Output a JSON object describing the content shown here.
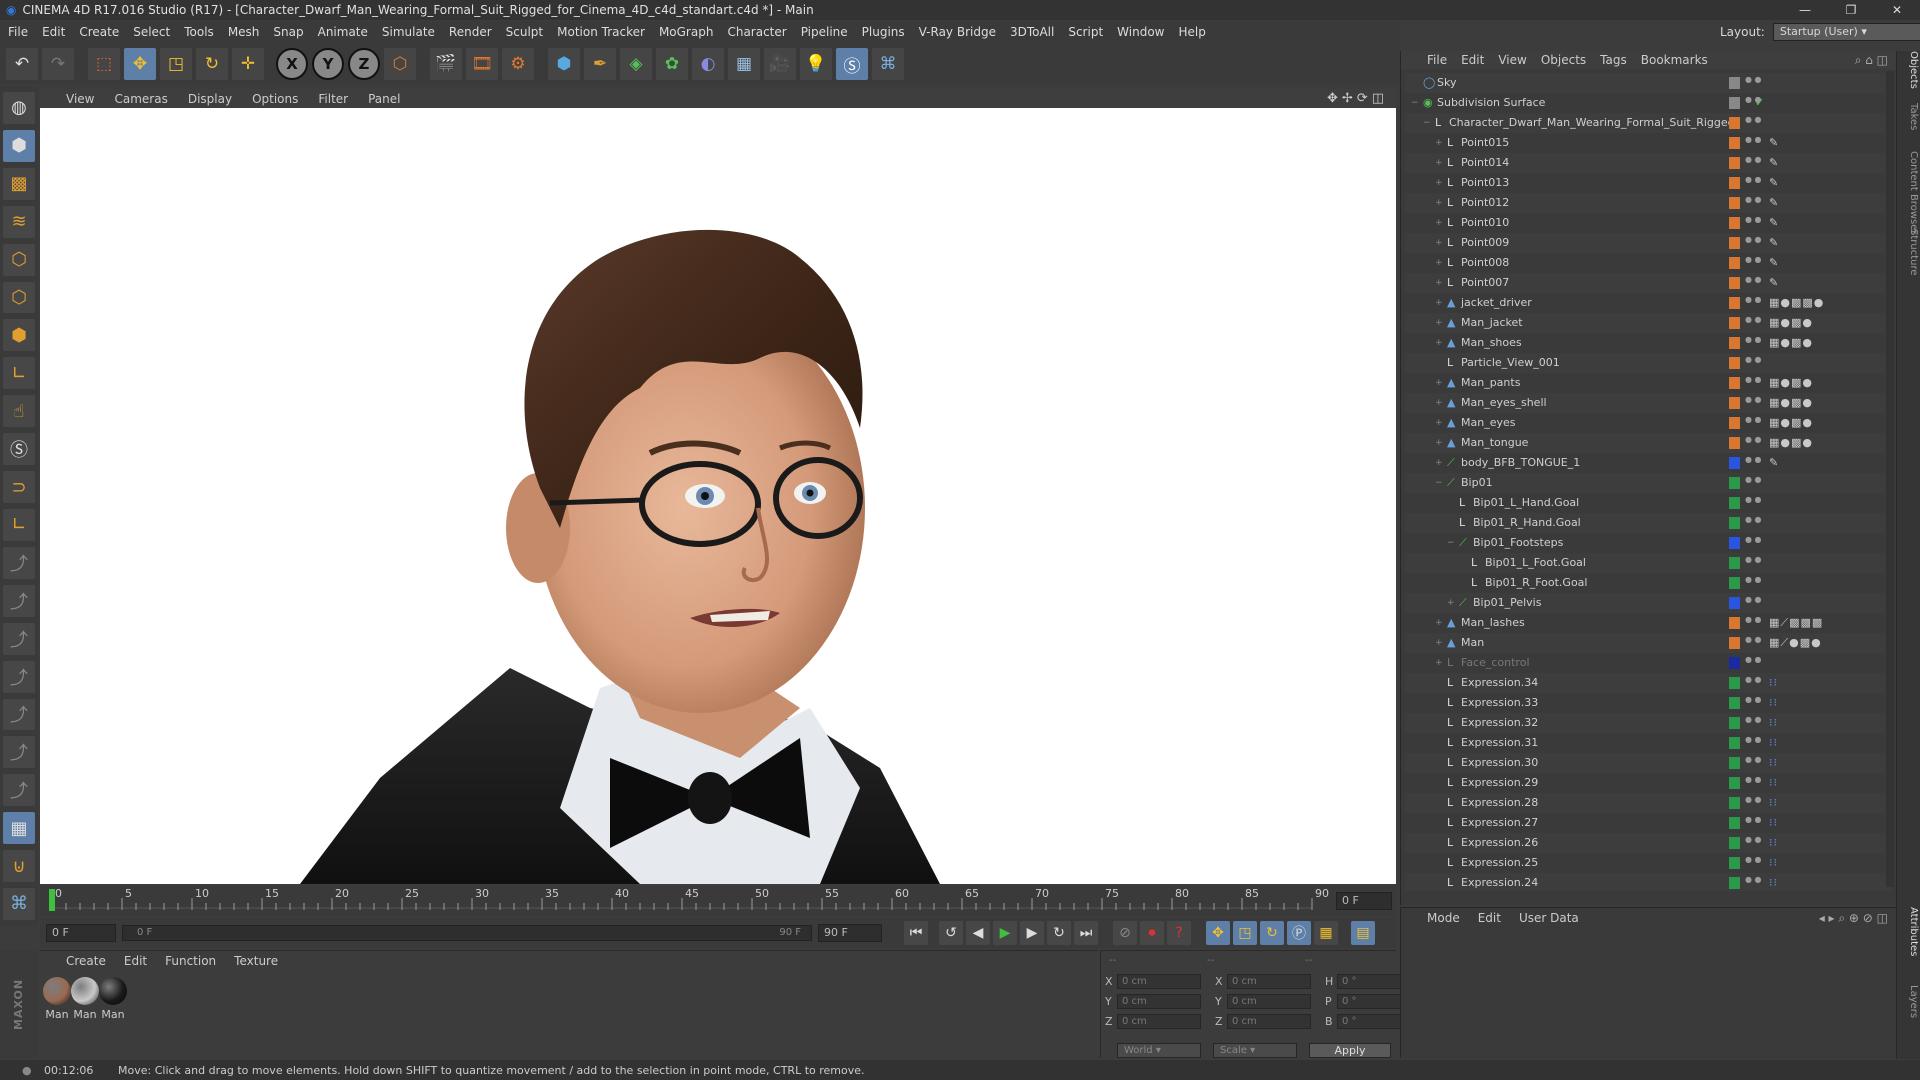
{
  "window": {
    "title": "CINEMA 4D R17.016 Studio (R17) - [Character_Dwarf_Man_Wearing_Formal_Suit_Rigged_for_Cinema_4D_c4d_standart.c4d *] - Main",
    "controls": [
      "—",
      "❐",
      "✕"
    ]
  },
  "menubar": [
    "File",
    "Edit",
    "Create",
    "Select",
    "Tools",
    "Mesh",
    "Snap",
    "Animate",
    "Simulate",
    "Render",
    "Sculpt",
    "Motion Tracker",
    "MoGraph",
    "Character",
    "Pipeline",
    "Plugins",
    "V-Ray Bridge",
    "3DToAll",
    "Script",
    "Window",
    "Help"
  ],
  "layout": {
    "label": "Layout:",
    "value": "Startup (User)"
  },
  "toolbar": {
    "axes": [
      "X",
      "Y",
      "Z"
    ],
    "icons": [
      "undo-icon",
      "redo-icon",
      "live-select-icon",
      "move-icon",
      "scale-icon",
      "rotate-icon",
      "last-tool-icon",
      "coordinate-system-icon",
      "render-view-icon",
      "render-picture-viewer-icon",
      "render-settings-icon",
      "cube-icon",
      "pen-icon",
      "subdivision-icon",
      "cloner-icon",
      "deformer-icon",
      "floor-icon",
      "camera-icon",
      "light-icon",
      "spline-tool-icon",
      "python-icon"
    ]
  },
  "viewport": {
    "menu": [
      "View",
      "Cameras",
      "Display",
      "Options",
      "Filter",
      "Panel"
    ]
  },
  "timeline": {
    "ticks": [
      "0",
      "5",
      "10",
      "15",
      "20",
      "25",
      "30",
      "35",
      "40",
      "45",
      "50",
      "55",
      "60",
      "65",
      "70",
      "75",
      "80",
      "85",
      "90"
    ],
    "current_frame": "0 F",
    "start_field": "0 F",
    "range_start": "0 F",
    "range_end": "90 F",
    "end_field": "90 F"
  },
  "materials": {
    "menu": [
      "Create",
      "Edit",
      "Function",
      "Texture"
    ],
    "items": [
      {
        "label": "Man",
        "color": "#9a6a52"
      },
      {
        "label": "Man",
        "color": "#c9c9c9"
      },
      {
        "label": "Man",
        "color": "#1a1a1a"
      }
    ]
  },
  "coords": {
    "header": [
      "--",
      "--",
      "--"
    ],
    "rows": [
      {
        "a": "X",
        "av": "0 cm",
        "b": "X",
        "bv": "0 cm",
        "c": "H",
        "cv": "0 °"
      },
      {
        "a": "Y",
        "av": "0 cm",
        "b": "Y",
        "bv": "0 cm",
        "c": "P",
        "cv": "0 °"
      },
      {
        "a": "Z",
        "av": "0 cm",
        "b": "Z",
        "bv": "0 cm",
        "c": "B",
        "cv": "0 °"
      }
    ],
    "world": "World",
    "scale": "Scale",
    "apply": "Apply"
  },
  "status": {
    "time": "00:12:06",
    "message": "Move: Click and drag to move elements. Hold down SHIFT to quantize movement / add to the selection in point mode, CTRL to remove."
  },
  "objects_menu": [
    "File",
    "Edit",
    "View",
    "Objects",
    "Tags",
    "Bookmarks"
  ],
  "objects": [
    {
      "name": "Sky",
      "depth": 0,
      "ex": "",
      "icon": "◯",
      "iconColor": "#6aa0d8",
      "sq": "#888888",
      "check": "",
      "tags": ""
    },
    {
      "name": "Subdivision Surface",
      "depth": 0,
      "ex": "−",
      "icon": "◉",
      "iconColor": "#55c055",
      "sq": "#888888",
      "check": "✓",
      "tags": ""
    },
    {
      "name": "Character_Dwarf_Man_Wearing_Formal_Suit_Rigged",
      "depth": 1,
      "ex": "−",
      "icon": "L",
      "iconColor": "#dddddd",
      "sq": "#d9762f",
      "check": "",
      "tags": ""
    },
    {
      "name": "Point015",
      "depth": 2,
      "ex": "+",
      "icon": "L",
      "iconColor": "#dddddd",
      "sq": "#d9762f",
      "check": "",
      "tags": "✎"
    },
    {
      "name": "Point014",
      "depth": 2,
      "ex": "+",
      "icon": "L",
      "iconColor": "#dddddd",
      "sq": "#d9762f",
      "check": "",
      "tags": "✎"
    },
    {
      "name": "Point013",
      "depth": 2,
      "ex": "+",
      "icon": "L",
      "iconColor": "#dddddd",
      "sq": "#d9762f",
      "check": "",
      "tags": "✎"
    },
    {
      "name": "Point012",
      "depth": 2,
      "ex": "+",
      "icon": "L",
      "iconColor": "#dddddd",
      "sq": "#d9762f",
      "check": "",
      "tags": "✎"
    },
    {
      "name": "Point010",
      "depth": 2,
      "ex": "+",
      "icon": "L",
      "iconColor": "#dddddd",
      "sq": "#d9762f",
      "check": "",
      "tags": "✎"
    },
    {
      "name": "Point009",
      "depth": 2,
      "ex": "+",
      "icon": "L",
      "iconColor": "#dddddd",
      "sq": "#d9762f",
      "check": "",
      "tags": "✎"
    },
    {
      "name": "Point008",
      "depth": 2,
      "ex": "+",
      "icon": "L",
      "iconColor": "#dddddd",
      "sq": "#d9762f",
      "check": "",
      "tags": "✎"
    },
    {
      "name": "Point007",
      "depth": 2,
      "ex": "+",
      "icon": "L",
      "iconColor": "#dddddd",
      "sq": "#d9762f",
      "check": "",
      "tags": "✎"
    },
    {
      "name": "jacket_driver",
      "depth": 2,
      "ex": "+",
      "icon": "▲",
      "iconColor": "#6aa0d8",
      "sq": "#d9762f",
      "check": "",
      "tags": "▦●▩▩●"
    },
    {
      "name": "Man_jacket",
      "depth": 2,
      "ex": "+",
      "icon": "▲",
      "iconColor": "#6aa0d8",
      "sq": "#d9762f",
      "check": "",
      "tags": "▦●▩●"
    },
    {
      "name": "Man_shoes",
      "depth": 2,
      "ex": "+",
      "icon": "▲",
      "iconColor": "#6aa0d8",
      "sq": "#d9762f",
      "check": "",
      "tags": "▦●▩●"
    },
    {
      "name": "Particle_View_001",
      "depth": 2,
      "ex": "",
      "icon": "L",
      "iconColor": "#dddddd",
      "sq": "#d9762f",
      "check": "",
      "tags": ""
    },
    {
      "name": "Man_pants",
      "depth": 2,
      "ex": "+",
      "icon": "▲",
      "iconColor": "#6aa0d8",
      "sq": "#d9762f",
      "check": "",
      "tags": "▦●▩●"
    },
    {
      "name": "Man_eyes_shell",
      "depth": 2,
      "ex": "+",
      "icon": "▲",
      "iconColor": "#6aa0d8",
      "sq": "#d9762f",
      "check": "",
      "tags": "▦●▩●"
    },
    {
      "name": "Man_eyes",
      "depth": 2,
      "ex": "+",
      "icon": "▲",
      "iconColor": "#6aa0d8",
      "sq": "#d9762f",
      "check": "",
      "tags": "▦●▩●"
    },
    {
      "name": "Man_tongue",
      "depth": 2,
      "ex": "+",
      "icon": "▲",
      "iconColor": "#6aa0d8",
      "sq": "#d9762f",
      "check": "",
      "tags": "▦●▩●"
    },
    {
      "name": "body_BFB_TONGUE_1",
      "depth": 2,
      "ex": "+",
      "icon": "⟋",
      "iconColor": "#55c055",
      "sq": "#2a55e0",
      "check": "",
      "tags": "✎"
    },
    {
      "name": "Bip01",
      "depth": 2,
      "ex": "−",
      "icon": "⟋",
      "iconColor": "#55c055",
      "sq": "#2a9a4a",
      "check": "",
      "tags": ""
    },
    {
      "name": "Bip01_L_Hand.Goal",
      "depth": 3,
      "ex": "",
      "icon": "L",
      "iconColor": "#dddddd",
      "sq": "#2a9a4a",
      "check": "",
      "tags": ""
    },
    {
      "name": "Bip01_R_Hand.Goal",
      "depth": 3,
      "ex": "",
      "icon": "L",
      "iconColor": "#dddddd",
      "sq": "#2a9a4a",
      "check": "",
      "tags": ""
    },
    {
      "name": "Bip01_Footsteps",
      "depth": 3,
      "ex": "−",
      "icon": "⟋",
      "iconColor": "#55c055",
      "sq": "#2a55e0",
      "check": "",
      "tags": ""
    },
    {
      "name": "Bip01_L_Foot.Goal",
      "depth": 4,
      "ex": "",
      "icon": "L",
      "iconColor": "#dddddd",
      "sq": "#2a9a4a",
      "check": "",
      "tags": ""
    },
    {
      "name": "Bip01_R_Foot.Goal",
      "depth": 4,
      "ex": "",
      "icon": "L",
      "iconColor": "#dddddd",
      "sq": "#2a9a4a",
      "check": "",
      "tags": ""
    },
    {
      "name": "Bip01_Pelvis",
      "depth": 3,
      "ex": "+",
      "icon": "⟋",
      "iconColor": "#55c055",
      "sq": "#2a55e0",
      "check": "",
      "tags": ""
    },
    {
      "name": "Man_lashes",
      "depth": 2,
      "ex": "+",
      "icon": "▲",
      "iconColor": "#6aa0d8",
      "sq": "#d9762f",
      "check": "",
      "tags": "▦⟋▩▩▩"
    },
    {
      "name": "Man",
      "depth": 2,
      "ex": "+",
      "icon": "▲",
      "iconColor": "#6aa0d8",
      "sq": "#d9762f",
      "check": "",
      "tags": "▦⟋●▩●"
    },
    {
      "name": "Face_control",
      "depth": 2,
      "ex": "+",
      "icon": "L",
      "iconColor": "#777777",
      "sq": "#1a2aa0",
      "check": "",
      "tags": "",
      "dim": true
    },
    {
      "name": "Expression.34",
      "depth": 2,
      "ex": "",
      "icon": "L",
      "iconColor": "#dddddd",
      "sq": "#2a9a4a",
      "check": "",
      "tags": "⁝⁝"
    },
    {
      "name": "Expression.33",
      "depth": 2,
      "ex": "",
      "icon": "L",
      "iconColor": "#dddddd",
      "sq": "#2a9a4a",
      "check": "",
      "tags": "⁝⁝"
    },
    {
      "name": "Expression.32",
      "depth": 2,
      "ex": "",
      "icon": "L",
      "iconColor": "#dddddd",
      "sq": "#2a9a4a",
      "check": "",
      "tags": "⁝⁝"
    },
    {
      "name": "Expression.31",
      "depth": 2,
      "ex": "",
      "icon": "L",
      "iconColor": "#dddddd",
      "sq": "#2a9a4a",
      "check": "",
      "tags": "⁝⁝"
    },
    {
      "name": "Expression.30",
      "depth": 2,
      "ex": "",
      "icon": "L",
      "iconColor": "#dddddd",
      "sq": "#2a9a4a",
      "check": "",
      "tags": "⁝⁝"
    },
    {
      "name": "Expression.29",
      "depth": 2,
      "ex": "",
      "icon": "L",
      "iconColor": "#dddddd",
      "sq": "#2a9a4a",
      "check": "",
      "tags": "⁝⁝"
    },
    {
      "name": "Expression.28",
      "depth": 2,
      "ex": "",
      "icon": "L",
      "iconColor": "#dddddd",
      "sq": "#2a9a4a",
      "check": "",
      "tags": "⁝⁝"
    },
    {
      "name": "Expression.27",
      "depth": 2,
      "ex": "",
      "icon": "L",
      "iconColor": "#dddddd",
      "sq": "#2a9a4a",
      "check": "",
      "tags": "⁝⁝"
    },
    {
      "name": "Expression.26",
      "depth": 2,
      "ex": "",
      "icon": "L",
      "iconColor": "#dddddd",
      "sq": "#2a9a4a",
      "check": "",
      "tags": "⁝⁝"
    },
    {
      "name": "Expression.25",
      "depth": 2,
      "ex": "",
      "icon": "L",
      "iconColor": "#dddddd",
      "sq": "#2a9a4a",
      "check": "",
      "tags": "⁝⁝"
    },
    {
      "name": "Expression.24",
      "depth": 2,
      "ex": "",
      "icon": "L",
      "iconColor": "#dddddd",
      "sq": "#2a9a4a",
      "check": "",
      "tags": "⁝⁝"
    }
  ],
  "attributes_menu": [
    "Mode",
    "Edit",
    "User Data"
  ],
  "right_tabs": [
    "Objects",
    "Takes",
    "Content Browser",
    "Structure",
    "Attributes",
    "Layers"
  ]
}
